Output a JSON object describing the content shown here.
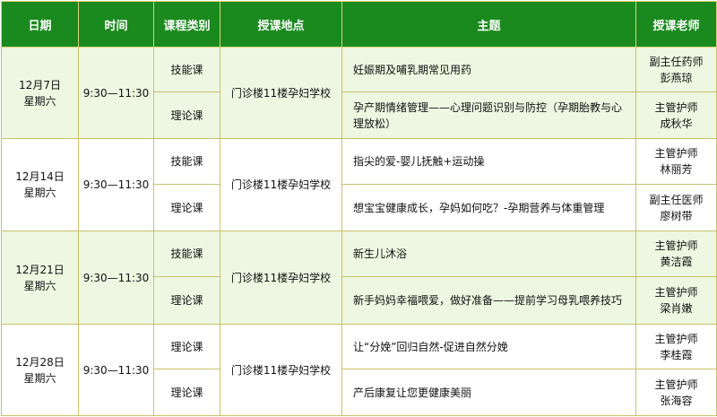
{
  "headers": {
    "date": "日期",
    "time": "时间",
    "category": "课程类别",
    "location": "授课地点",
    "topic": "主题",
    "teacher": "授课老师"
  },
  "groups": [
    {
      "date": "12月7日",
      "weekday": "星期六",
      "time": "9:30—11:30",
      "location": "门诊楼11楼孕妇学校",
      "sessions": [
        {
          "category": "技能课",
          "topic": "妊娠期及哺乳期常见用药",
          "teacher_title": "副主任药师",
          "teacher_name": "彭燕琼"
        },
        {
          "category": "理论课",
          "topic": "孕产期情绪管理——心理问题识别与防控（孕期胎教与心理放松）",
          "teacher_title": "主管护师",
          "teacher_name": "成秋华"
        }
      ]
    },
    {
      "date": "12月14日",
      "weekday": "星期六",
      "time": "9:30—11:30",
      "location": "门诊楼11楼孕妇学校",
      "sessions": [
        {
          "category": "技能课",
          "topic": "指尖的爱-婴儿抚触+运动操",
          "teacher_title": "主管护师",
          "teacher_name": "林丽芳"
        },
        {
          "category": "理论课",
          "topic": "想宝宝健康成长，孕妈如何吃？-孕期营养与体重管理",
          "teacher_title": "副主任医师",
          "teacher_name": "廖树带"
        }
      ]
    },
    {
      "date": "12月21日",
      "weekday": "星期六",
      "time": "9:30—11:30",
      "location": "门诊楼11楼孕妇学校",
      "sessions": [
        {
          "category": "技能课",
          "topic": "新生儿沐浴",
          "teacher_title": "主管护师",
          "teacher_name": "黄洁霞"
        },
        {
          "category": "理论课",
          "topic": "新手妈妈幸福喂爱，做好准备——提前学习母乳喂养技巧",
          "teacher_title": "主管护师",
          "teacher_name": "梁肖嫩"
        }
      ]
    },
    {
      "date": "12月28日",
      "weekday": "星期六",
      "time": "9:30—11:30",
      "location": "门诊楼11楼孕妇学校",
      "sessions": [
        {
          "category": "理论课",
          "topic": "让“分娩”回归自然-促进自然分娩",
          "teacher_title": "主管护师",
          "teacher_name": "李桂霞"
        },
        {
          "category": "理论课",
          "topic": "产后康复让您更健康美丽",
          "teacher_title": "主管护师",
          "teacher_name": "张海容"
        }
      ]
    }
  ]
}
